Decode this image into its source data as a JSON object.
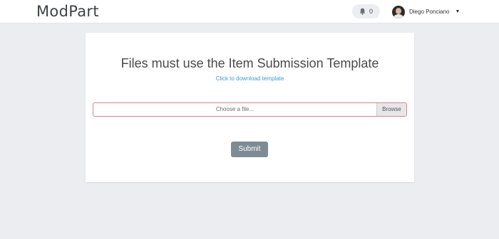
{
  "navbar": {
    "brand": "ModPart",
    "notifications": {
      "icon": "bell-icon",
      "count": "0"
    },
    "user": {
      "name": "Diego Ponciano",
      "avatar": "avatar",
      "menu_icon": "chevron-down-icon"
    }
  },
  "main": {
    "title": "Files must use the Item Submission Template",
    "template_link": "Click to download template",
    "file_input": {
      "placeholder": "Choose a file...",
      "browse_label": "Browse"
    },
    "submit_label": "Submit"
  },
  "colors": {
    "background": "#ecedf0",
    "link": "#3b9bd7",
    "input_border": "#e0828f",
    "submit_button": "#7f8b94"
  }
}
